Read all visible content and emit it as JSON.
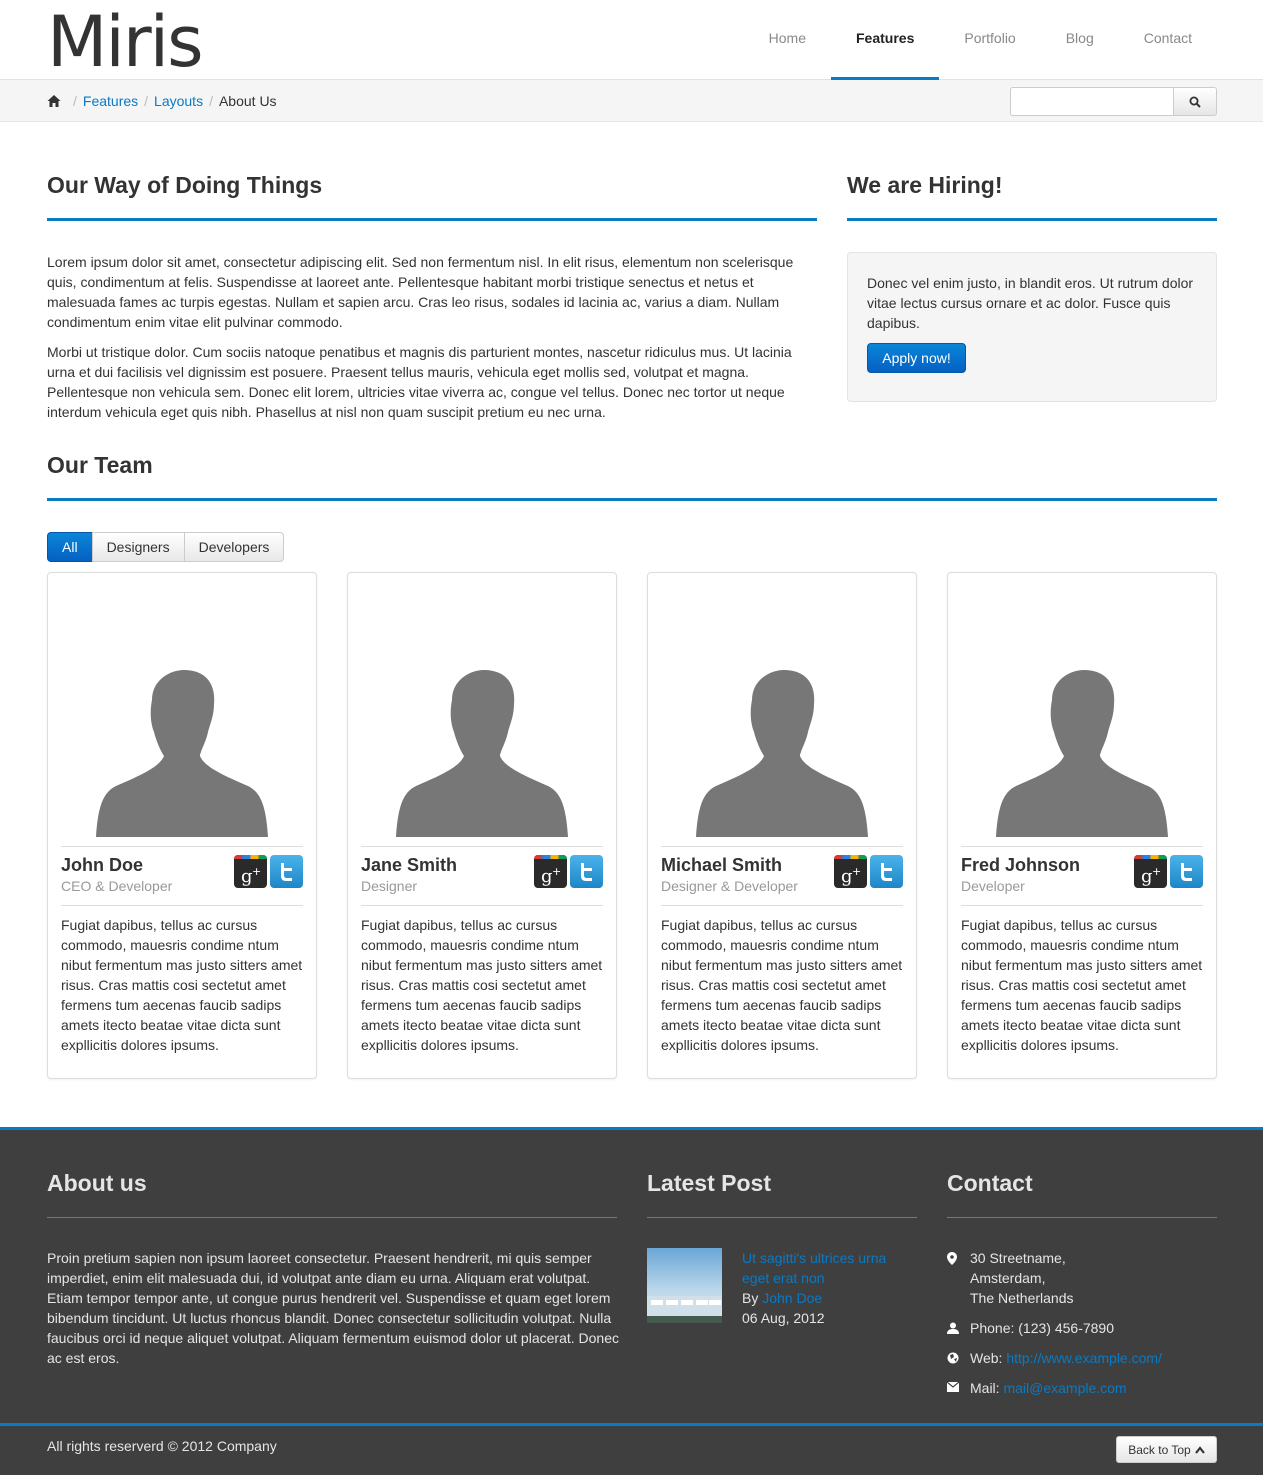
{
  "header": {
    "logo": "Miris",
    "nav": [
      "Home",
      "Features",
      "Portfolio",
      "Blog",
      "Contact"
    ],
    "active_nav": "Features"
  },
  "breadcrumb": {
    "items": [
      "Features",
      "Layouts"
    ],
    "current": "About Us"
  },
  "search": {
    "placeholder": ""
  },
  "intro": {
    "title": "Our Way of Doing Things",
    "paragraphs": [
      "Lorem ipsum dolor sit amet, consectetur adipiscing elit. Sed non fermentum nisl. In elit risus, elementum non scelerisque quis, condimentum at felis. Suspendisse at laoreet ante. Pellentesque habitant morbi tristique senectus et netus et malesuada fames ac turpis egestas. Nullam et sapien arcu. Cras leo risus, sodales id lacinia ac, varius a diam. Nullam condimentum enim vitae elit pulvinar commodo.",
      "Morbi ut tristique dolor. Cum sociis natoque penatibus et magnis dis parturient montes, nascetur ridiculus mus. Ut lacinia urna et dui facilisis vel dignissim est posuere. Praesent tellus mauris, vehicula eget mollis sed, volutpat et magna. Pellentesque non vehicula sem. Donec elit lorem, ultricies vitae viverra ac, congue vel tellus. Donec nec tortor ut neque interdum vehicula eget quis nibh. Phasellus at nisl non quam suscipit pretium eu nec urna."
    ]
  },
  "hiring": {
    "title": "We are Hiring!",
    "text": "Donec vel enim justo, in blandit eros. Ut rutrum dolor vitae lectus cursus ornare et ac dolor. Fusce quis dapibus.",
    "button": "Apply now!"
  },
  "team": {
    "title": "Our Team",
    "filters": [
      "All",
      "Designers",
      "Developers"
    ],
    "active_filter": "All",
    "members": [
      {
        "name": "John Doe",
        "role": "CEO & Developer",
        "bio": "Fugiat dapibus, tellus ac cursus commodo, mauesris condime ntum nibut fermentum mas justo sitters amet risus. Cras mattis cosi sectetut amet fermens tum aecenas faucib sadips amets itecto beatae vitae dicta sunt expllicitis dolores ipsums."
      },
      {
        "name": "Jane Smith",
        "role": "Designer",
        "bio": "Fugiat dapibus, tellus ac cursus commodo, mauesris condime ntum nibut fermentum mas justo sitters amet risus. Cras mattis cosi sectetut amet fermens tum aecenas faucib sadips amets itecto beatae vitae dicta sunt expllicitis dolores ipsums."
      },
      {
        "name": "Michael Smith",
        "role": "Designer & Developer",
        "bio": "Fugiat dapibus, tellus ac cursus commodo, mauesris condime ntum nibut fermentum mas justo sitters amet risus. Cras mattis cosi sectetut amet fermens tum aecenas faucib sadips amets itecto beatae vitae dicta sunt expllicitis dolores ipsums."
      },
      {
        "name": "Fred Johnson",
        "role": "Developer",
        "bio": "Fugiat dapibus, tellus ac cursus commodo, mauesris condime ntum nibut fermentum mas justo sitters amet risus. Cras mattis cosi sectetut amet fermens tum aecenas faucib sadips amets itecto beatae vitae dicta sunt expllicitis dolores ipsums."
      }
    ]
  },
  "footer": {
    "about": {
      "title": "About us",
      "text": "Proin pretium sapien non ipsum laoreet consectetur. Praesent hendrerit, mi quis semper imperdiet, enim elit malesuada dui, id volutpat ante diam eu urna. Aliquam erat volutpat. Etiam tempor tempor ante, ut congue purus hendrerit vel. Suspendisse et quam eget lorem bibendum tincidunt. Ut luctus rhoncus blandit. Donec consectetur sollicitudin volutpat. Nulla faucibus orci id neque aliquet volutpat. Aliquam fermentum euismod dolor ut placerat. Donec ac est eros."
    },
    "latest_post": {
      "title": "Latest Post",
      "post_title": "Ut sagitti's ultrices urna eget erat non",
      "by": "By",
      "author": "John Doe",
      "date": "06 Aug, 2012"
    },
    "contact": {
      "title": "Contact",
      "address": [
        "30 Streetname,",
        "Amsterdam,",
        "The Netherlands"
      ],
      "phone": "Phone: (123) 456-7890",
      "web_label": "Web:",
      "web": "http://www.example.com/",
      "mail_label": "Mail:",
      "mail": "mail@example.com"
    },
    "copyright": "All rights reserverd © 2012 Company",
    "back_to_top": "Back to Top"
  },
  "colors": {
    "accent": "#0a7ac4",
    "footer_bg": "#3f3f3f",
    "avatar": "#777777"
  }
}
